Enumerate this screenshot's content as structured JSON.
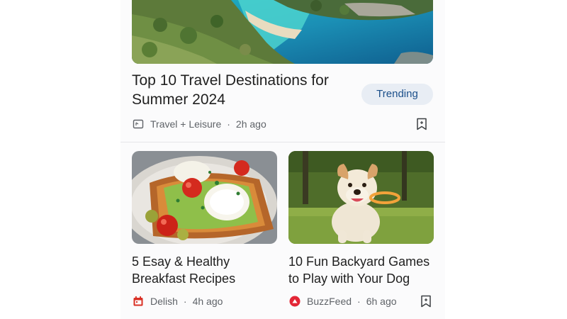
{
  "hero": {
    "title": "Top 10 Travel Destinations for Summer 2024",
    "chip": "Trending",
    "source": "Travel + Leisure",
    "time": "2h ago",
    "separator": "·",
    "source_icon": "news-source-icon",
    "save_icon": "bookmark-icon"
  },
  "cards": [
    {
      "title": "5 Esay & Healthy Breakfast Recipes",
      "source": "Delish",
      "time": "4h ago",
      "separator": "·",
      "source_icon": "calendar-icon",
      "source_color": "#d93025"
    },
    {
      "title": "10 Fun Backyard Games to Play with Your Dog",
      "source": "BuzzFeed",
      "time": "6h ago",
      "separator": "·",
      "source_icon": "buzzfeed-logo-icon",
      "source_color": "#e32636",
      "save_icon": "bookmark-icon"
    }
  ],
  "colors": {
    "chip_bg": "#e8edf4",
    "chip_text": "#1b4f8a",
    "meta_text": "#5f6368"
  }
}
